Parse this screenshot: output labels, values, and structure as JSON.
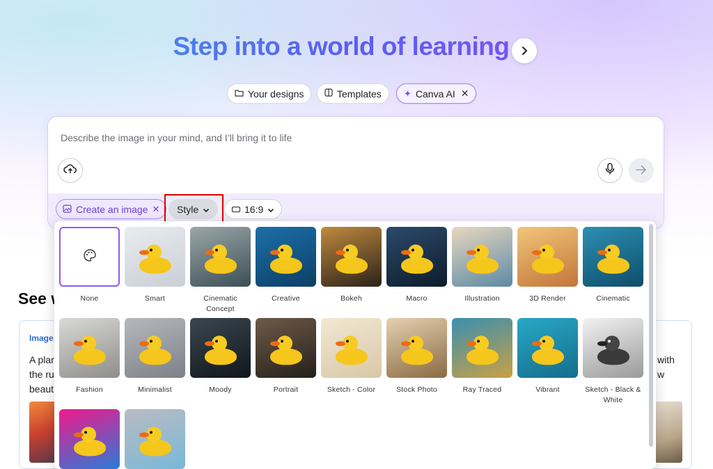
{
  "hero": {
    "title": "Step into a world of learning",
    "next_icon": "chevron-right-icon"
  },
  "tabs": [
    {
      "label": "Your designs",
      "icon": "folder-icon"
    },
    {
      "label": "Templates",
      "icon": "template-icon"
    },
    {
      "label": "Canva AI",
      "icon": "sparkle-icon",
      "active": true
    }
  ],
  "composer": {
    "placeholder": "Describe the image in your mind, and I’ll bring it to life",
    "create_chip": "Create an image",
    "style_chip": "Style",
    "ratio_chip": "16:9"
  },
  "background": {
    "section_title": "See w",
    "card_label": "Image",
    "card_text_lines": [
      "A plar",
      "the ru",
      "beaut"
    ],
    "card_text_right_lines": [
      "with",
      "w"
    ]
  },
  "style_options": [
    {
      "label": "None",
      "colors": [
        "#ffffff",
        "#ffffff"
      ]
    },
    {
      "label": "Smart",
      "colors": [
        "#e9ecef",
        "#c9cfd6"
      ]
    },
    {
      "label": "Cinematic Concept",
      "colors": [
        "#9aa7a8",
        "#3c4f57"
      ]
    },
    {
      "label": "Creative",
      "colors": [
        "#1d6fa8",
        "#0c3f66"
      ]
    },
    {
      "label": "Bokeh",
      "colors": [
        "#c08a3e",
        "#2a221a"
      ]
    },
    {
      "label": "Macro",
      "colors": [
        "#2b4a6b",
        "#0e1c2b"
      ]
    },
    {
      "label": "Illustration",
      "colors": [
        "#e8d7bf",
        "#5c8aa6"
      ]
    },
    {
      "label": "3D Render",
      "colors": [
        "#f2c57a",
        "#c2763a"
      ]
    },
    {
      "label": "Cinematic",
      "colors": [
        "#2d8fb3",
        "#0e4d6a"
      ]
    },
    {
      "label": "Fashion",
      "colors": [
        "#d9d9d6",
        "#8e8d8a"
      ]
    },
    {
      "label": "Minimalist",
      "colors": [
        "#b5b8bd",
        "#7d8187"
      ]
    },
    {
      "label": "Moody",
      "colors": [
        "#3a4650",
        "#11171c"
      ]
    },
    {
      "label": "Portrait",
      "colors": [
        "#6e5a48",
        "#24201c"
      ]
    },
    {
      "label": "Sketch - Color",
      "colors": [
        "#f2e7d2",
        "#d8c8a8"
      ]
    },
    {
      "label": "Stock Photo",
      "colors": [
        "#e4d0b0",
        "#8a6a44"
      ]
    },
    {
      "label": "Ray Traced",
      "colors": [
        "#3a8fb0",
        "#c9a046"
      ]
    },
    {
      "label": "Vibrant",
      "colors": [
        "#2aa7c6",
        "#136e8c"
      ]
    },
    {
      "label": "Sketch - Black & White",
      "colors": [
        "#f2f2f2",
        "#9a9a9a"
      ]
    },
    {
      "label": "",
      "colors": [
        "#f0198c",
        "#2a7bd6"
      ]
    },
    {
      "label": "",
      "colors": [
        "#b8bcc2",
        "#7ab8d8"
      ]
    }
  ],
  "icons": {
    "upload": "cloud-upload-icon",
    "mic": "microphone-icon",
    "send": "arrow-right-icon",
    "palette": "palette-icon"
  },
  "colors": {
    "accent": "#8b5cf6",
    "highlight": "#e00000"
  }
}
